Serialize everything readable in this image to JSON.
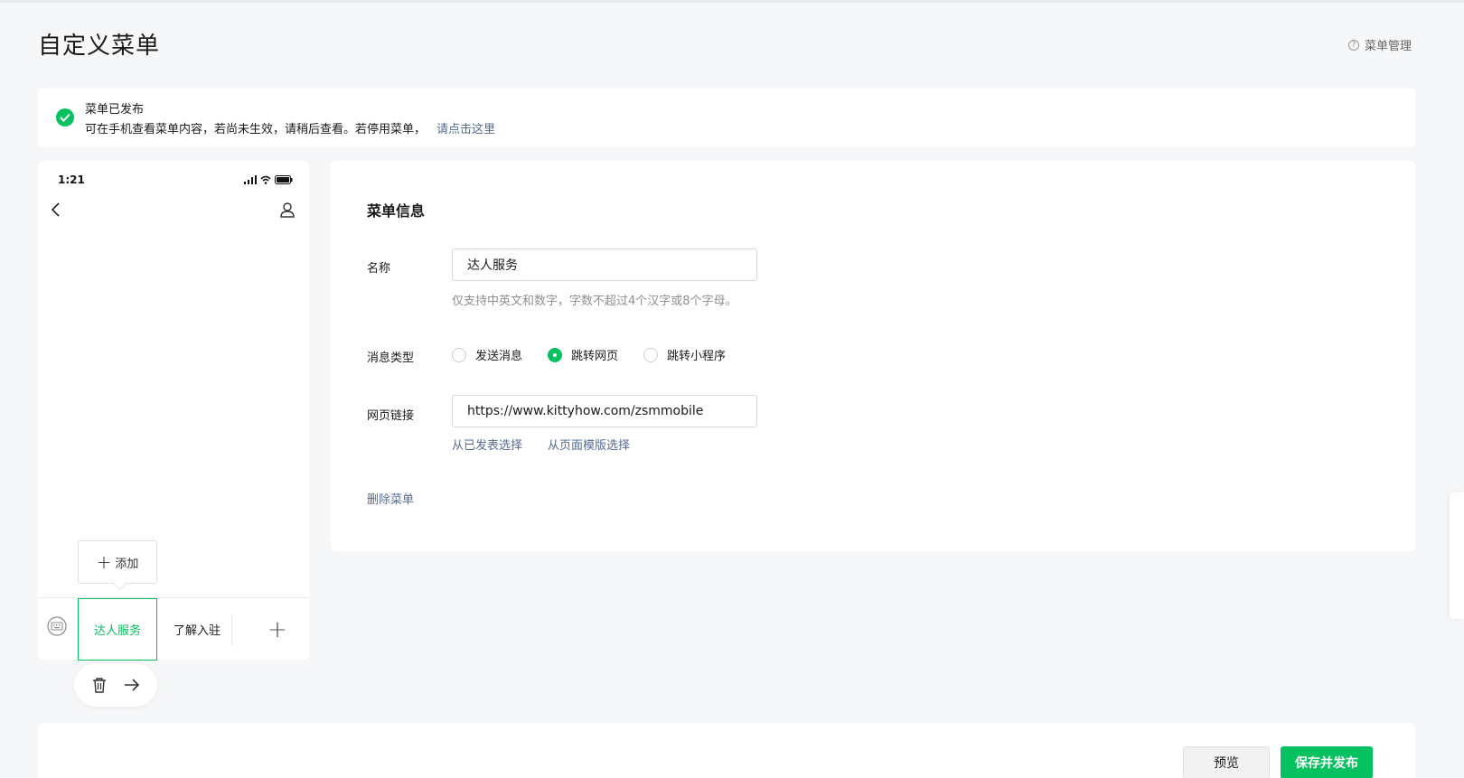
{
  "page": {
    "title": "自定义菜单",
    "menu_manage": "菜单管理"
  },
  "notice": {
    "title": "菜单已发布",
    "desc": "可在手机查看菜单内容，若尚未生效，请稍后查看。若停用菜单，",
    "link": "请点击这里"
  },
  "phone": {
    "time": "1:21",
    "add_label": "添加",
    "menus": [
      "达人服务",
      "了解入驻"
    ],
    "add_symbol": "+"
  },
  "editor": {
    "title": "菜单信息",
    "name_label": "名称",
    "name_value": "达人服务",
    "name_hint": "仅支持中英文和数字，字数不超过4个汉字或8个字母。",
    "type_label": "消息类型",
    "type_options": [
      {
        "label": "发送消息",
        "checked": false
      },
      {
        "label": "跳转网页",
        "checked": true
      },
      {
        "label": "跳转小程序",
        "checked": false
      }
    ],
    "url_label": "网页链接",
    "url_value": "https://www.kittyhow.com/zsmmobile",
    "link_published": "从已发表选择",
    "link_template": "从页面模版选择",
    "delete_menu": "删除菜单"
  },
  "footer": {
    "preview": "预览",
    "publish": "保存并发布"
  },
  "colors": {
    "accent": "#07c160",
    "link": "#576b95"
  },
  "icons": [
    "help-icon",
    "check-circle-icon",
    "signal-icon",
    "wifi-icon",
    "battery-icon",
    "back-icon",
    "user-icon",
    "plus-icon",
    "keyboard-icon",
    "trash-icon",
    "arrow-right-icon"
  ]
}
